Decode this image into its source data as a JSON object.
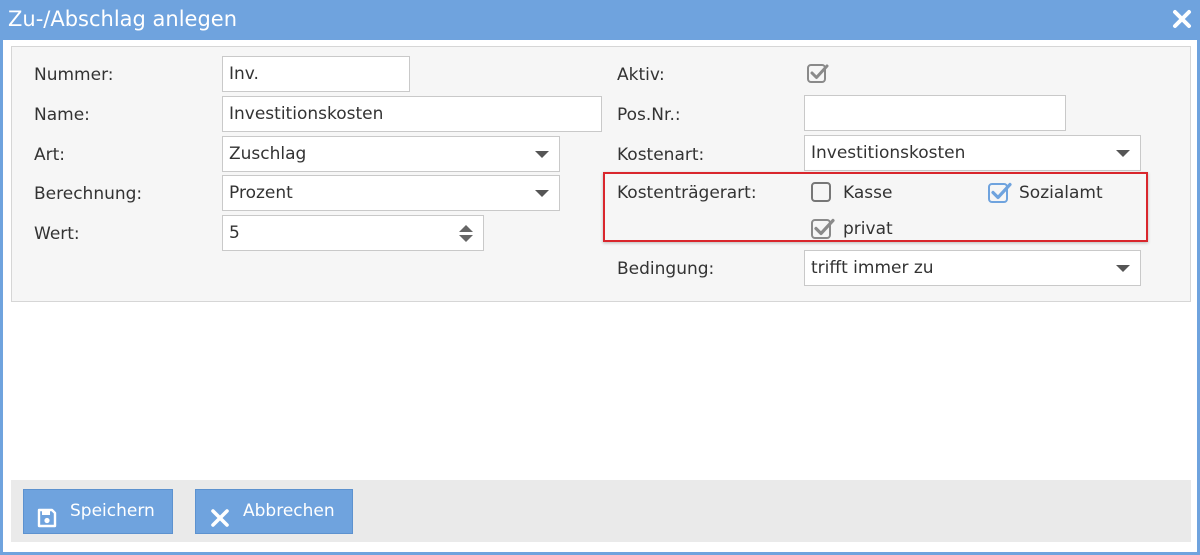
{
  "dialog": {
    "title": "Zu-/Abschlag anlegen"
  },
  "left": {
    "nummer": {
      "label": "Nummer:",
      "value": "Inv."
    },
    "name": {
      "label": "Name:",
      "value": "Investitionskosten"
    },
    "art": {
      "label": "Art:",
      "value": "Zuschlag"
    },
    "berechnung": {
      "label": "Berechnung:",
      "value": "Prozent"
    },
    "wert": {
      "label": "Wert:",
      "value": "5"
    }
  },
  "right": {
    "aktiv": {
      "label": "Aktiv:",
      "checked": true
    },
    "posnr": {
      "label": "Pos.Nr.:",
      "value": ""
    },
    "kostenart": {
      "label": "Kostenart:",
      "value": "Investitionskosten"
    },
    "kostentraegerart": {
      "label": "Kostenträgerart:",
      "options": [
        {
          "label": "Kasse",
          "checked": false
        },
        {
          "label": "Sozialamt",
          "checked": true
        },
        {
          "label": "privat",
          "checked": true
        }
      ]
    },
    "bedingung": {
      "label": "Bedingung:",
      "value": "trifft immer zu"
    }
  },
  "footer": {
    "save_label": "Speichern",
    "cancel_label": "Abbrechen"
  },
  "colors": {
    "accent": "#6fa3de",
    "highlight": "#d9262c",
    "checked_blue": "#6fa3de",
    "checked_gray": "#8a8a8a"
  },
  "icons": {
    "close": "close-icon",
    "save": "floppy-disk-icon",
    "cancel": "x-icon"
  }
}
